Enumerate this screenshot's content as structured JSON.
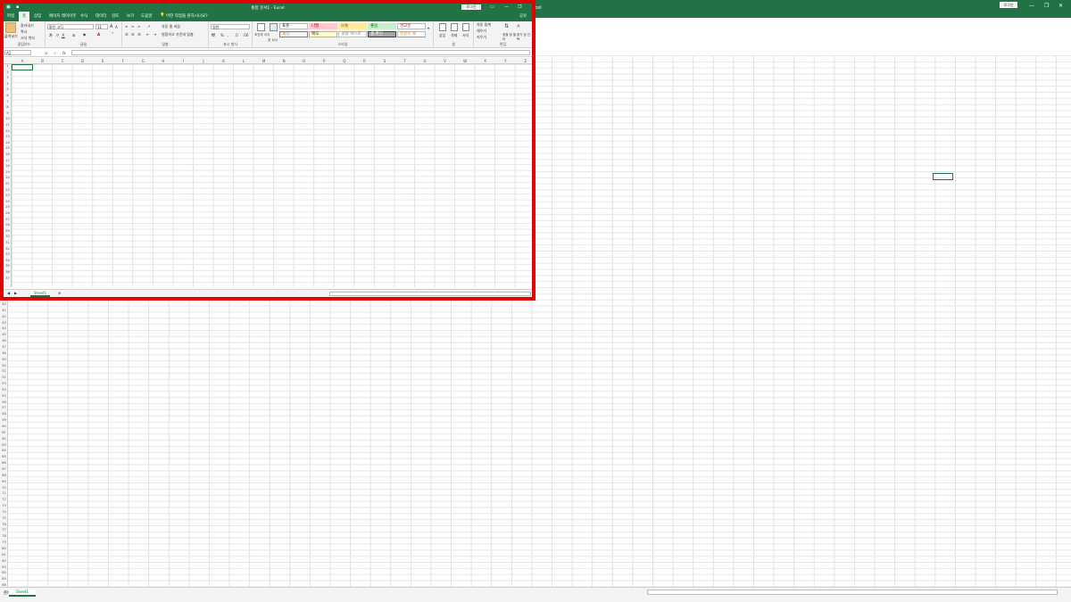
{
  "app": {
    "title": "통합 문서1 - Excel",
    "bg_title": "Excel",
    "login_label": "로그인"
  },
  "tabs": [
    "파일",
    "홈",
    "삽입",
    "페이지 레이아웃",
    "수식",
    "데이터",
    "검토",
    "보기",
    "도움말"
  ],
  "search_hint": "어떤 작업을 원하시나요?",
  "share_label": "공유",
  "clipboard": {
    "paste": "붙여넣기",
    "cut": "잘라내기",
    "copy": "복사",
    "format_painter": "서식 복사",
    "label": "클립보드"
  },
  "font": {
    "name": "맑은 고딕",
    "size": "11",
    "bold": "가",
    "italic": "가",
    "underline": "가",
    "label": "글꼴"
  },
  "alignment": {
    "wrap": "자동 줄 바꿈",
    "merge": "병합하고 가운데 맞춤",
    "label": "맞춤"
  },
  "number": {
    "format": "일반",
    "percent": "%",
    "comma": ",",
    "label": "표시 형식"
  },
  "styles": {
    "cond_format": "조건부 서식",
    "format_table": "표 서식",
    "cells": [
      "표준",
      "나쁨",
      "보통",
      "좋음",
      "경고문",
      "계산",
      "메모",
      "설명 텍스트",
      "셀 확인",
      "연결된 셀"
    ],
    "label": "스타일"
  },
  "cells_group": {
    "insert": "삽입",
    "delete": "삭제",
    "format": "서식",
    "label": "셀"
  },
  "editing": {
    "autosum": "자동 합계",
    "fill": "채우기",
    "clear": "지우기",
    "sort": "정렬 및 필터",
    "find": "찾기 및 선택",
    "label": "편집"
  },
  "namebox": "A1",
  "formula": {
    "cancel": "×",
    "enter": "✓",
    "fx": "fx"
  },
  "columns": [
    "A",
    "B",
    "C",
    "D",
    "E",
    "F",
    "G",
    "H",
    "I",
    "J",
    "K",
    "L",
    "M",
    "N",
    "O",
    "P",
    "Q",
    "R",
    "S",
    "T",
    "U",
    "V",
    "W",
    "X",
    "Y",
    "Z"
  ],
  "bg_columns": [
    "AA",
    "AB",
    "AC",
    "AD",
    "AE",
    "AF",
    "AG",
    "AH",
    "AI",
    "AJ",
    "AK",
    "AL",
    "AM",
    "AN",
    "AO",
    "AP",
    "AQ",
    "AR",
    "AS",
    "AT",
    "AU",
    "AV",
    "AW",
    "AX",
    "AY",
    "AZ",
    "BA"
  ],
  "rows": [
    "1",
    "2",
    "3",
    "4",
    "5",
    "6",
    "7",
    "8",
    "9",
    "10",
    "11",
    "12",
    "13",
    "14",
    "15",
    "16",
    "17",
    "18",
    "19",
    "20",
    "21",
    "22",
    "23",
    "24",
    "25",
    "26",
    "27",
    "28",
    "29",
    "30",
    "31",
    "32",
    "33",
    "34",
    "35",
    "36",
    "37"
  ],
  "bg_rows": [
    "40",
    "41",
    "42",
    "43",
    "44",
    "45",
    "46",
    "47",
    "48",
    "49",
    "50",
    "51",
    "52",
    "53",
    "54",
    "55",
    "56",
    "57",
    "58",
    "59",
    "60",
    "61",
    "62",
    "63",
    "64",
    "65",
    "66",
    "67",
    "68",
    "69",
    "70",
    "71",
    "72",
    "73",
    "74",
    "75",
    "76",
    "77",
    "78",
    "79",
    "80",
    "81",
    "82",
    "83",
    "84",
    "85",
    "86"
  ],
  "sheet": "Sheet1",
  "status": {
    "ready": "준비",
    "zoom": "100%"
  },
  "colors": {
    "accent": "#217346",
    "highlight": "#e00000"
  }
}
